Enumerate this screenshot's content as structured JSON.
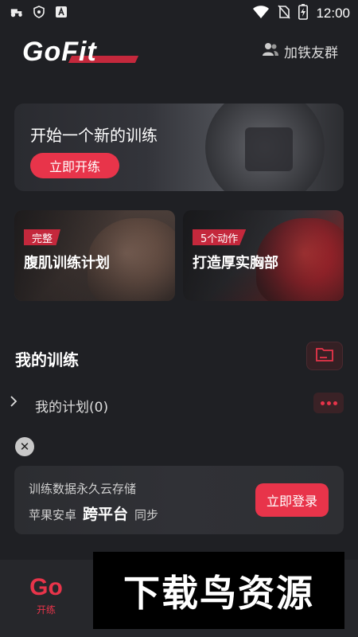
{
  "status_bar": {
    "time": "12:00"
  },
  "header": {
    "logo": "GoFit",
    "join_group": "加铁友群"
  },
  "hero": {
    "title": "开始一个新的训练",
    "button": "立即开练"
  },
  "plans": [
    {
      "tag": "完整",
      "title": "腹肌训练计划"
    },
    {
      "tag": "5个动作",
      "title": "打造厚实胸部"
    }
  ],
  "my_training": {
    "title": "我的训练",
    "plan_row": "我的计划(0)"
  },
  "login_card": {
    "line1": "训练数据永久云存储",
    "line2_prefix": "苹果安卓",
    "line2_emph": "跨平台",
    "line2_suffix": "同步",
    "button": "立即登录"
  },
  "bottom_nav": {
    "go_logo": "Go",
    "go_label": "开练"
  },
  "watermark": {
    "text": "下载鸟资源"
  },
  "colors": {
    "accent": "#e8344a",
    "background": "#1f2024"
  }
}
